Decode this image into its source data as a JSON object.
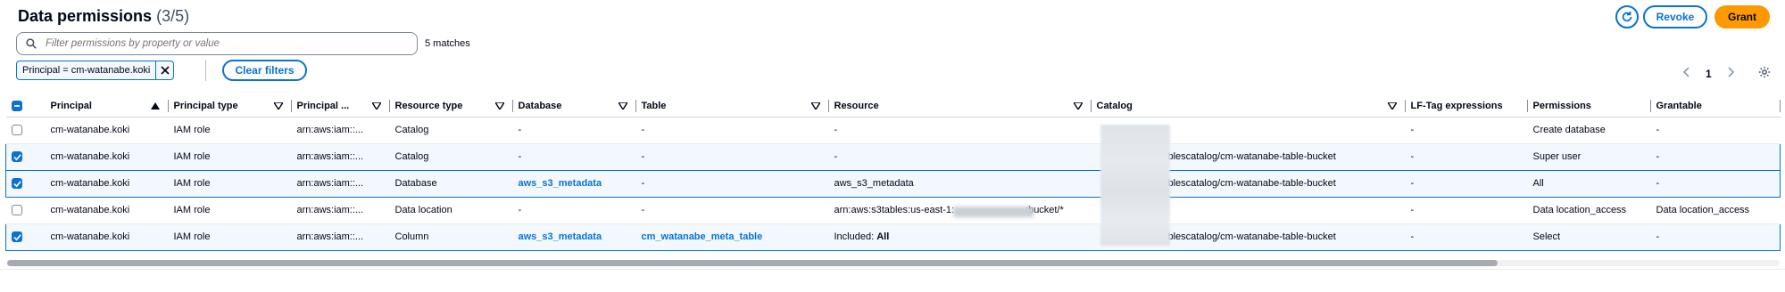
{
  "header": {
    "title": "Data permissions",
    "count": "(3/5)",
    "refresh_icon": "refresh-icon",
    "revoke_label": "Revoke",
    "grant_label": "Grant"
  },
  "filter": {
    "placeholder": "Filter permissions by property or value",
    "matches": "5 matches",
    "token_label": "Principal = cm-watanabe.koki",
    "clear_label": "Clear filters"
  },
  "pagination": {
    "page": "1"
  },
  "table": {
    "columns": [
      "Principal",
      "Principal type",
      "Principal ...",
      "Resource type",
      "Database",
      "Table",
      "Resource",
      "Catalog",
      "LF-Tag expressions",
      "Permissions",
      "Grantable"
    ],
    "rows": [
      {
        "selected": false,
        "cells": [
          "cm-watanabe.koki",
          "IAM role",
          "arn:aws:iam::...",
          "Catalog",
          "-",
          "-",
          "-",
          "2",
          "-",
          "Create database",
          "-"
        ]
      },
      {
        "selected": true,
        "cells": [
          "cm-watanabe.koki",
          "IAM role",
          "arn:aws:iam::...",
          "Catalog",
          "-",
          "-",
          "-",
          "2:s3tablescatalog/cm-watanabe-table-bucket",
          "-",
          "Super user",
          "-"
        ]
      },
      {
        "selected": true,
        "cells": [
          "cm-watanabe.koki",
          "IAM role",
          "arn:aws:iam::...",
          "Database",
          "aws_s3_metadata",
          "-",
          "aws_s3_metadata",
          "2:s3tablescatalog/cm-watanabe-table-bucket",
          "-",
          "All",
          "-"
        ]
      },
      {
        "selected": false,
        "cells": [
          "cm-watanabe.koki",
          "IAM role",
          "arn:aws:iam::...",
          "Data location",
          "-",
          "-",
          "arn:aws:s3tables:us-east-1:",
          "2",
          "-",
          "Data location_access",
          "Data location_access"
        ],
        "resource_suffix": ":bucket/*"
      },
      {
        "selected": true,
        "cells": [
          "cm-watanabe.koki",
          "IAM role",
          "arn:aws:iam::...",
          "Column",
          "aws_s3_metadata",
          "cm_watanabe_meta_table",
          "Included: ",
          "2:s3tablescatalog/cm-watanabe-table-bucket",
          "-",
          "Select",
          "-"
        ],
        "resource_bold": "All"
      }
    ]
  },
  "colors": {
    "accent": "#0972d3",
    "primary_button": "#ff9900",
    "selected_row_bg": "#f2f8fd"
  }
}
